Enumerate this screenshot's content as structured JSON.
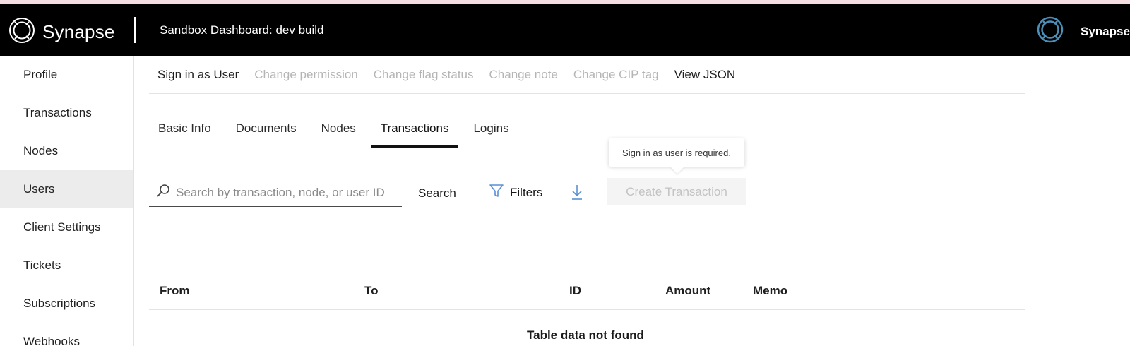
{
  "header": {
    "brand": "Synapse",
    "title": "Sandbox Dashboard: dev build",
    "user_name": "SynapseF"
  },
  "sidebar": {
    "items": [
      {
        "label": "Profile"
      },
      {
        "label": "Transactions"
      },
      {
        "label": "Nodes"
      },
      {
        "label": "Users"
      },
      {
        "label": "Client Settings"
      },
      {
        "label": "Tickets"
      },
      {
        "label": "Subscriptions"
      },
      {
        "label": "Webhooks"
      }
    ],
    "active": "Users"
  },
  "actions": {
    "sign_in": "Sign in as User",
    "change_permission": "Change permission",
    "change_flag_status": "Change flag status",
    "change_note": "Change note",
    "change_cip_tag": "Change CIP tag",
    "view_json": "View JSON"
  },
  "tabs": [
    {
      "label": "Basic Info"
    },
    {
      "label": "Documents"
    },
    {
      "label": "Nodes"
    },
    {
      "label": "Transactions"
    },
    {
      "label": "Logins"
    }
  ],
  "active_tab": "Transactions",
  "toolbar": {
    "search_placeholder": "Search by transaction, node, or user ID",
    "search_label": "Search",
    "filters_label": "Filters",
    "create_label": "Create Transaction",
    "tooltip": "Sign in as user is required."
  },
  "table": {
    "columns": [
      "From",
      "To",
      "ID",
      "Amount",
      "Memo"
    ],
    "empty_message": "Table data not found"
  },
  "colors": {
    "header_bg": "#000000",
    "accent_blue": "#5b8fd6",
    "disabled_text": "#b5b5b5"
  },
  "icons": [
    "synapse-logo-icon",
    "search-icon",
    "filter-icon",
    "download-icon",
    "user-avatar-icon"
  ]
}
